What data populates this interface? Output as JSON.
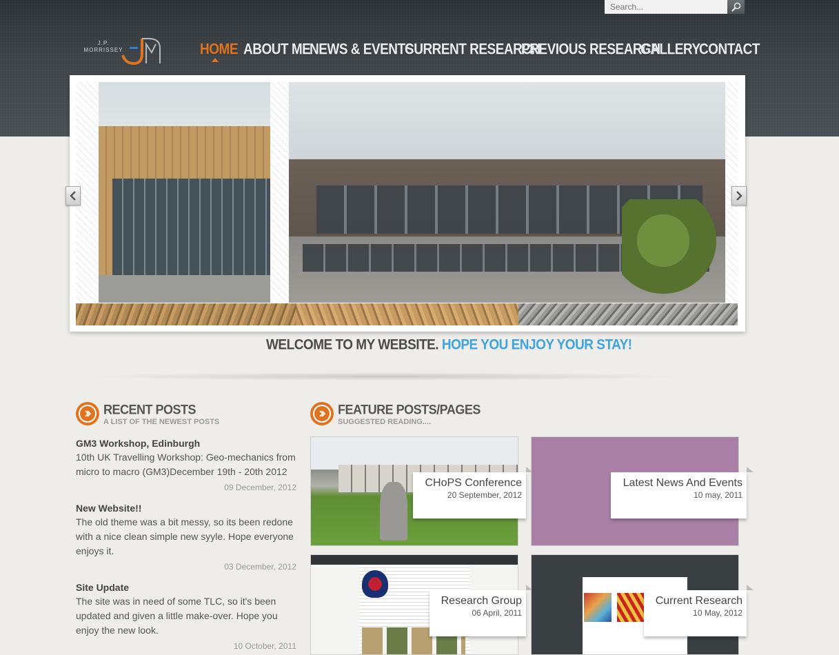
{
  "search": {
    "placeholder": "Search..."
  },
  "logo": {
    "line1": "J.P.",
    "line2": "MORRISSEY",
    "mark": "JPM"
  },
  "nav": {
    "items": [
      {
        "label": "Home",
        "active": true
      },
      {
        "label": "About Me"
      },
      {
        "label": "News & Events"
      },
      {
        "label": "Current Research"
      },
      {
        "label": "Previous Research"
      },
      {
        "label": "Gallery"
      },
      {
        "label": "Contact"
      }
    ]
  },
  "welcome": {
    "part1": "Welcome to my website.",
    "part2": "Hope you enjoy your stay!"
  },
  "recent": {
    "title": "Recent Posts",
    "subtitle": "A list of the newest posts",
    "posts": [
      {
        "title": "GM3 Workshop, Edinburgh",
        "body": "10th UK Travelling Workshop: Geo-mechanics from micro to macro (GM3)December 19th - 20th 2012",
        "date": "09 December, 2012"
      },
      {
        "title": "New Website!!",
        "body": "The old theme was a bit messy, so its been redone with a nice clean simple new syyle. Hope everyone enjoys it.",
        "date": "03 December, 2012"
      },
      {
        "title": "Site Update",
        "body": "The site was in need of some TLC, so it's been updated and given a little make-over. Hope you enjoy the new look.",
        "date": "10 October, 2011"
      }
    ]
  },
  "feature": {
    "title": "Feature Posts/Pages",
    "subtitle": "Suggested reading....",
    "cards": [
      {
        "title": "CHoPS Conference",
        "date": "20 September, 2012"
      },
      {
        "title": "Latest News And Events",
        "date": "10 may, 2011"
      },
      {
        "title": "Research Group",
        "date": "06 April, 2011"
      },
      {
        "title": "Current Research",
        "date": "10 May, 2012"
      }
    ]
  },
  "colors": {
    "accent": "#e0731f",
    "welcome_highlight": "#3fa3dc",
    "header": "#3d4346"
  }
}
